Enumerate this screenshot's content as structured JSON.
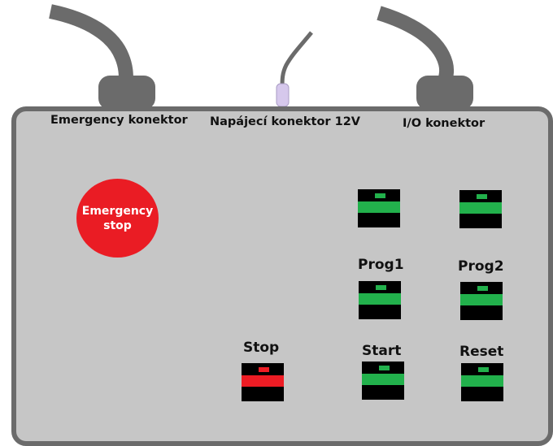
{
  "connectors": {
    "emergency_label": "Emergency konektor",
    "power_label": "Napájecí konektor 12V",
    "io_label": "I/O konektor"
  },
  "emergency_stop": {
    "label": "Emergency\nstop",
    "color": "#ea1c24"
  },
  "buttons": {
    "prog1_label": "Prog1",
    "prog2_label": "Prog2",
    "stop_label": "Stop",
    "start_label": "Start",
    "reset_label": "Reset"
  },
  "colors": {
    "housing": "#c6c6c6",
    "housing_border": "#6b6b6b",
    "cable": "#6b6b6b",
    "button_green": "#22b14c",
    "button_red": "#ed1c24",
    "power_plug": "#d6c8ec"
  }
}
